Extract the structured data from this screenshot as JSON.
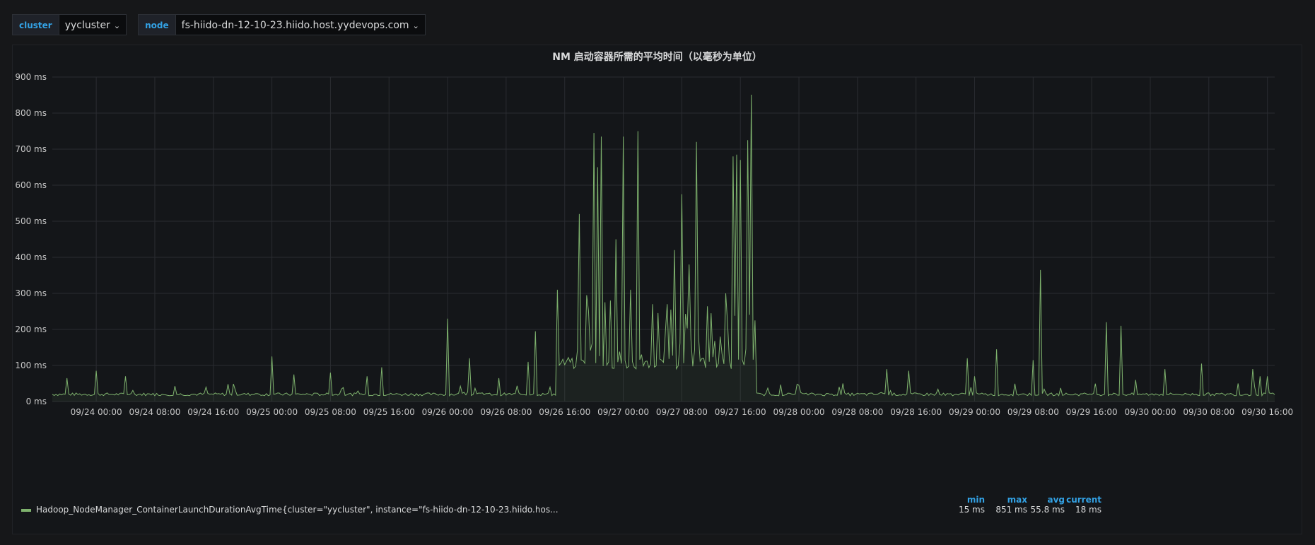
{
  "variables": [
    {
      "label": "cluster",
      "value": "yycluster"
    },
    {
      "label": "node",
      "value": "fs-hiido-dn-12-10-23.hiido.host.yydevops.com"
    }
  ],
  "panel": {
    "title": "NM 启动容器所需的平均时间（以毫秒为单位）"
  },
  "legend": {
    "series_label": "Hadoop_NodeManager_ContainerLaunchDurationAvgTime{cluster=\"yycluster\", instance=\"fs-hiido-dn-12-10-23.hiido.hos...",
    "headers": {
      "min": "min",
      "max": "max",
      "avg": "avg",
      "current": "current"
    },
    "values": {
      "min": "15 ms",
      "max": "851 ms",
      "avg": "55.8 ms",
      "current": "18 ms"
    }
  },
  "chart_data": {
    "type": "area",
    "ylim": [
      0,
      900
    ],
    "y_ticks": [
      0,
      100,
      200,
      300,
      400,
      500,
      600,
      700,
      800,
      900
    ],
    "y_unit": "ms",
    "x_range": [
      "09/23 18:00",
      "09/30 17:00"
    ],
    "x_ticks": [
      "09/24 00:00",
      "09/24 08:00",
      "09/24 16:00",
      "09/25 00:00",
      "09/25 08:00",
      "09/25 16:00",
      "09/26 00:00",
      "09/26 08:00",
      "09/26 16:00",
      "09/27 00:00",
      "09/27 08:00",
      "09/27 16:00",
      "09/28 00:00",
      "09/28 08:00",
      "09/28 16:00",
      "09/29 00:00",
      "09/29 08:00",
      "09/29 16:00",
      "09/30 00:00",
      "09/30 08:00",
      "09/30 16:00"
    ],
    "grid": true,
    "line_color": "#7eb26d",
    "series": [
      {
        "name": "Hadoop_NodeManager_ContainerLaunchDurationAvgTime",
        "baseline_ms": 20,
        "elevated_window": {
          "start": "09/26 15:00",
          "end": "09/27 18:00",
          "level_ms": 105
        },
        "peaks": [
          {
            "t": "09/23 20:00",
            "v": 65
          },
          {
            "t": "09/24 00:00",
            "v": 85
          },
          {
            "t": "09/24 04:00",
            "v": 70
          },
          {
            "t": "09/24 15:00",
            "v": 40
          },
          {
            "t": "09/24 18:00",
            "v": 48
          },
          {
            "t": "09/25 00:00",
            "v": 125
          },
          {
            "t": "09/25 03:00",
            "v": 75
          },
          {
            "t": "09/25 08:00",
            "v": 80
          },
          {
            "t": "09/25 13:00",
            "v": 70
          },
          {
            "t": "09/25 15:00",
            "v": 95
          },
          {
            "t": "09/26 00:00",
            "v": 230
          },
          {
            "t": "09/26 03:00",
            "v": 120
          },
          {
            "t": "09/26 07:00",
            "v": 65
          },
          {
            "t": "09/26 11:00",
            "v": 110
          },
          {
            "t": "09/26 12:00",
            "v": 195
          },
          {
            "t": "09/26 14:00",
            "v": 40
          },
          {
            "t": "09/26 15:00",
            "v": 310
          },
          {
            "t": "09/26 18:00",
            "v": 520
          },
          {
            "t": "09/26 19:00",
            "v": 295
          },
          {
            "t": "09/26 20:00",
            "v": 745
          },
          {
            "t": "09/26 20:30",
            "v": 650
          },
          {
            "t": "09/26 21:00",
            "v": 735
          },
          {
            "t": "09/26 23:00",
            "v": 450
          },
          {
            "t": "09/27 00:00",
            "v": 735
          },
          {
            "t": "09/27 01:00",
            "v": 310
          },
          {
            "t": "09/27 02:00",
            "v": 750
          },
          {
            "t": "09/27 04:00",
            "v": 270
          },
          {
            "t": "09/27 06:00",
            "v": 270
          },
          {
            "t": "09/27 07:00",
            "v": 420
          },
          {
            "t": "09/27 08:00",
            "v": 575
          },
          {
            "t": "09/27 09:00",
            "v": 380
          },
          {
            "t": "09/27 10:00",
            "v": 720
          },
          {
            "t": "09/27 12:00",
            "v": 245
          },
          {
            "t": "09/27 14:00",
            "v": 300
          },
          {
            "t": "09/27 15:00",
            "v": 680
          },
          {
            "t": "09/27 15:30",
            "v": 685
          },
          {
            "t": "09/27 16:00",
            "v": 670
          },
          {
            "t": "09/27 17:00",
            "v": 725
          },
          {
            "t": "09/27 17:30",
            "v": 851
          },
          {
            "t": "09/27 18:00",
            "v": 225
          },
          {
            "t": "09/28 00:00",
            "v": 45
          },
          {
            "t": "09/28 06:00",
            "v": 50
          },
          {
            "t": "09/28 12:00",
            "v": 90
          },
          {
            "t": "09/28 15:00",
            "v": 85
          },
          {
            "t": "09/28 23:00",
            "v": 120
          },
          {
            "t": "09/29 00:00",
            "v": 70
          },
          {
            "t": "09/29 03:00",
            "v": 145
          },
          {
            "t": "09/29 08:00",
            "v": 115
          },
          {
            "t": "09/29 09:00",
            "v": 365
          },
          {
            "t": "09/29 18:00",
            "v": 220
          },
          {
            "t": "09/29 20:00",
            "v": 210
          },
          {
            "t": "09/29 22:00",
            "v": 60
          },
          {
            "t": "09/30 02:00",
            "v": 90
          },
          {
            "t": "09/30 07:00",
            "v": 105
          },
          {
            "t": "09/30 12:00",
            "v": 50
          },
          {
            "t": "09/30 14:00",
            "v": 90
          },
          {
            "t": "09/30 15:00",
            "v": 70
          },
          {
            "t": "09/30 16:00",
            "v": 70
          }
        ]
      }
    ]
  }
}
